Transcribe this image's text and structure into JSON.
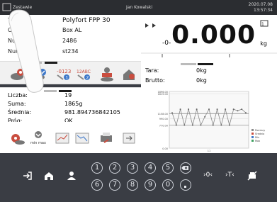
{
  "topbar": {
    "title": "Zestawie",
    "user": "Jan Kowalski",
    "date": "2020.07.08",
    "time": "13:57:34"
  },
  "product": {
    "rows": [
      {
        "label": "T",
        "value": "Polyfort FPP 30"
      },
      {
        "label": "Op",
        "value": "Box AL"
      },
      {
        "label": "Num",
        "value": "2486"
      },
      {
        "label": "Num",
        "value": "st234"
      }
    ]
  },
  "weight": {
    "value": "0.000",
    "unit": "kg",
    "zero_marker": "-0-"
  },
  "tara": {
    "tara_label": "Tara:",
    "tara_value": "0kg",
    "brutto_label": "Brutto:",
    "brutto_value": "0kg"
  },
  "stats": {
    "liczba_label": "Liczba:",
    "liczba_value": "19",
    "suma_label": "Suma:",
    "suma_value": "1865g",
    "srednia_label": "Średnia:",
    "srednia_value": "981.894736842105",
    "prog_label": "Próg:",
    "prog_value": "OK"
  },
  "icons": {
    "row1": [
      "settings-scale-icon",
      "scale-check-icon",
      "date-0123-icon",
      "code-12abc-icon",
      "user-scale-icon",
      "home-scale-icon"
    ],
    "row2_labels": [
      "",
      "min max",
      "",
      "",
      "",
      ""
    ]
  },
  "chart_data": {
    "type": "line",
    "y_tick_labels": [
      "1896.00",
      "1819.00",
      "1158.00",
      "990.00",
      "770.00",
      "0.00"
    ],
    "x_tick_labels": [
      "",
      "",
      "11",
      "",
      ""
    ],
    "legend": [
      "Pomiary",
      "Średnia",
      "Min",
      "Max"
    ],
    "values": [
      1180,
      770,
      1300,
      770,
      1300,
      770,
      1300,
      770,
      1050,
      1300,
      770,
      1300,
      770,
      1300,
      770,
      1300,
      1250,
      1300,
      1180
    ]
  },
  "keypad": {
    "digits_row1": [
      "1",
      "2",
      "3",
      "4",
      "5"
    ],
    "digits_row2": [
      "6",
      "7",
      "8",
      "9",
      "0"
    ],
    "icons": [
      "logout-icon",
      "home-icon",
      "user-icon",
      "backspace-icon",
      "dot-icon",
      "zero-icon",
      "tare-icon",
      "no-print-icon"
    ],
    "zero_label": "›0‹",
    "tare_label": "›T‹"
  }
}
